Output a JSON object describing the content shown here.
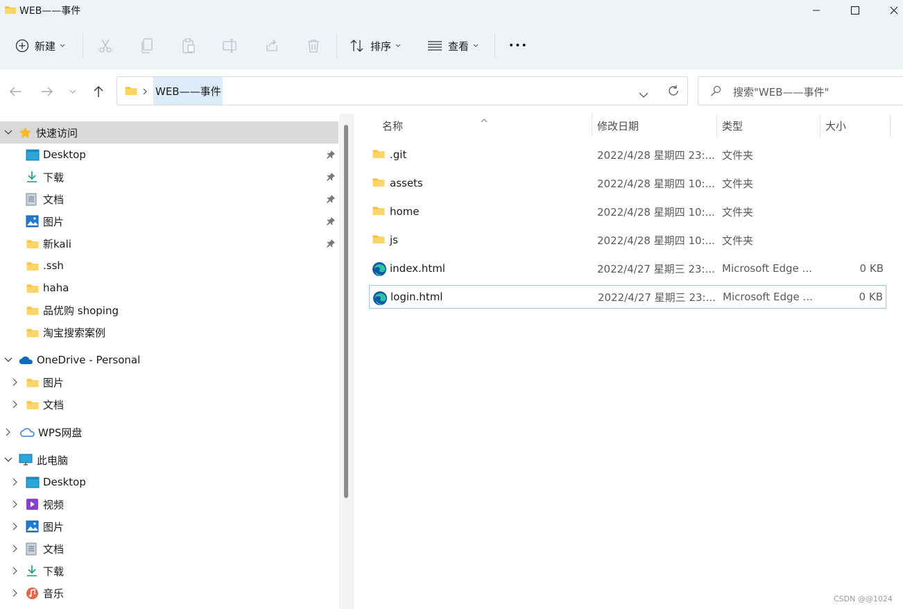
{
  "window": {
    "title": "WEB——事件",
    "minimize_glyph": "—",
    "maximize_glyph": "☐",
    "close_glyph": "✕"
  },
  "toolbar": {
    "new_label": "新建",
    "sort_label": "排序",
    "view_label": "查看",
    "more_label": "•••"
  },
  "address": {
    "crumb": "WEB——事件",
    "search_placeholder": "搜索\"WEB——事件\""
  },
  "nav": {
    "quick_access": "快速访问",
    "quick_items": [
      {
        "label": "Desktop",
        "icon": "desktop-icon",
        "pinned": true
      },
      {
        "label": "下载",
        "icon": "download-icon",
        "pinned": true
      },
      {
        "label": "文档",
        "icon": "documents-icon",
        "pinned": true
      },
      {
        "label": "图片",
        "icon": "pictures-icon",
        "pinned": true
      },
      {
        "label": "新kali",
        "icon": "folder-icon",
        "pinned": true
      },
      {
        "label": ".ssh",
        "icon": "folder-icon",
        "pinned": false
      },
      {
        "label": "haha",
        "icon": "folder-icon",
        "pinned": false
      },
      {
        "label": "品优购 shoping",
        "icon": "folder-icon",
        "pinned": false
      },
      {
        "label": "淘宝搜索案例",
        "icon": "folder-icon",
        "pinned": false
      }
    ],
    "onedrive": "OneDrive - Personal",
    "onedrive_items": [
      "图片",
      "文档"
    ],
    "wps": "WPS网盘",
    "this_pc": "此电脑",
    "pc_items": [
      {
        "label": "Desktop",
        "icon": "desktop-icon"
      },
      {
        "label": "视频",
        "icon": "videos-icon"
      },
      {
        "label": "图片",
        "icon": "pictures-icon"
      },
      {
        "label": "文档",
        "icon": "documents-icon"
      },
      {
        "label": "下载",
        "icon": "download-icon"
      },
      {
        "label": "音乐",
        "icon": "music-icon"
      }
    ]
  },
  "columns": {
    "name": "名称",
    "date": "修改日期",
    "type": "类型",
    "size": "大小"
  },
  "files": [
    {
      "name": ".git",
      "date": "2022/4/28 星期四 23:...",
      "type": "文件夹",
      "size": "",
      "icon": "folder-icon"
    },
    {
      "name": "assets",
      "date": "2022/4/28 星期四 10:...",
      "type": "文件夹",
      "size": "",
      "icon": "folder-icon"
    },
    {
      "name": "home",
      "date": "2022/4/28 星期四 10:...",
      "type": "文件夹",
      "size": "",
      "icon": "folder-icon"
    },
    {
      "name": "js",
      "date": "2022/4/28 星期四 10:...",
      "type": "文件夹",
      "size": "",
      "icon": "folder-icon"
    },
    {
      "name": "index.html",
      "date": "2022/4/27 星期三 23:...",
      "type": "Microsoft Edge ...",
      "size": "0 KB",
      "icon": "edge-icon"
    },
    {
      "name": "login.html",
      "date": "2022/4/27 星期三 23:...",
      "type": "Microsoft Edge ...",
      "size": "0 KB",
      "icon": "edge-icon"
    }
  ],
  "watermark": "CSDN @@1024",
  "colors": {
    "chrome_bg": "#eef3f7",
    "selection": "#dcecfb",
    "folder": "#f5c342",
    "focus_border": "#99c9ef"
  }
}
